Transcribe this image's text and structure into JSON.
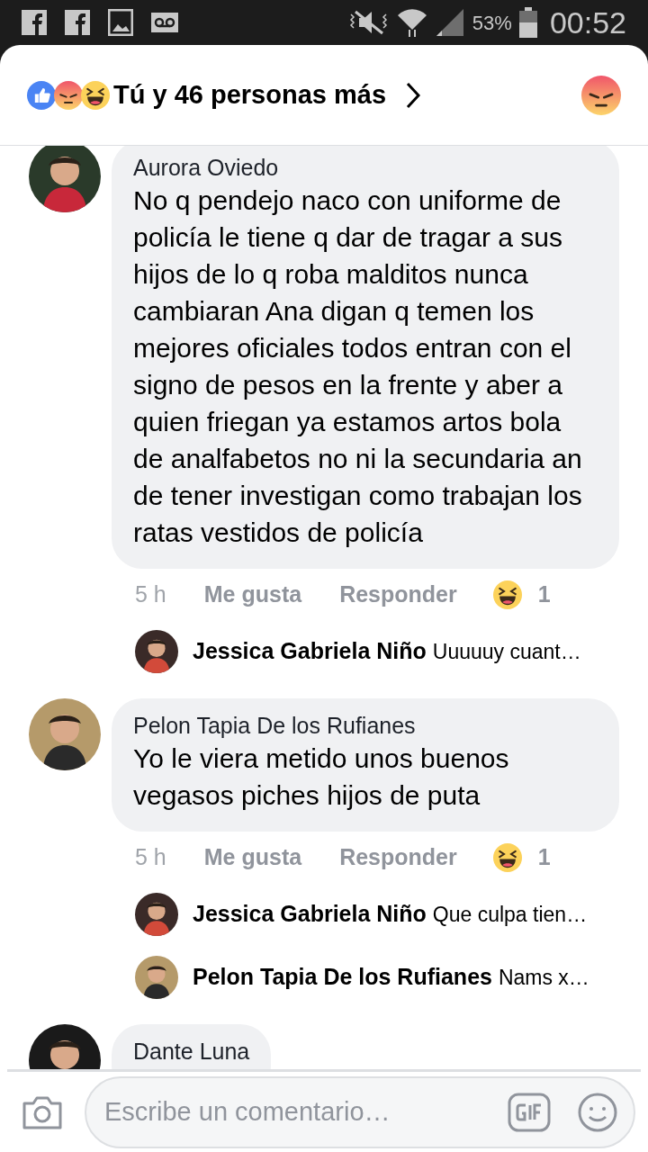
{
  "status_bar": {
    "battery": "53%",
    "time": "00:52"
  },
  "header": {
    "reactions": [
      {
        "kind": "like"
      },
      {
        "kind": "angry"
      },
      {
        "kind": "haha"
      }
    ],
    "title": "Tú y 46 personas más",
    "my_reaction": {
      "kind": "angry"
    }
  },
  "comments": [
    {
      "author": "Aurora Oviedo",
      "text": "No q pendejo naco con uniforme de policía le tiene q dar de tragar a sus hijos de lo q roba malditos nunca cambiaran Ana digan q temen los mejores oficiales todos entran con el signo de pesos en la frente y aber a quien friegan ya estamos artos bola de analfabetos no ni la secundaria an de tener investigan como trabajan los ratas vestidos de policía",
      "time": "5 h",
      "like": "Me gusta",
      "reply": "Responder",
      "reaction": {
        "kind": "haha",
        "count": "1"
      },
      "replies": [
        {
          "author": "Jessica Gabriela Niño",
          "text": "Uuuuuy cuant…"
        }
      ]
    },
    {
      "author": "Pelon Tapia De los Rufianes",
      "text": "Yo le viera metido unos buenos vegasos piches hijos de puta",
      "time": "5 h",
      "like": "Me gusta",
      "reply": "Responder",
      "reaction": {
        "kind": "haha",
        "count": "1"
      },
      "replies": [
        {
          "author": "Jessica Gabriela Niño",
          "text": "Que culpa tien…"
        },
        {
          "author": "Pelon Tapia De los Rufianes",
          "text": "Nams x…"
        }
      ]
    },
    {
      "author": "Dante Luna"
    }
  ],
  "composer": {
    "placeholder": "Escribe un comentario…"
  }
}
